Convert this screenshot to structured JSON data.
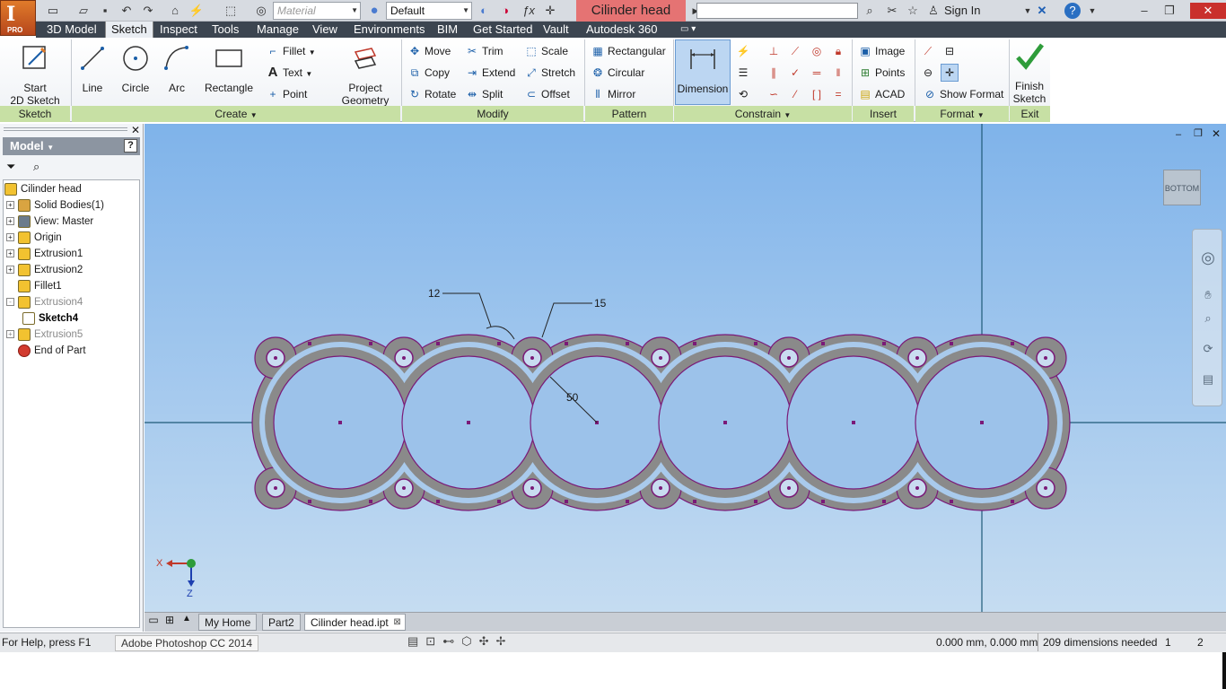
{
  "titlebar": {
    "material_placeholder": "Material",
    "appearance_value": "Default",
    "document_title": "Cilinder head",
    "signin_label": "Sign In"
  },
  "menu_tabs": [
    "3D Model",
    "Sketch",
    "Inspect",
    "Tools",
    "Manage",
    "View",
    "Environments",
    "BIM",
    "Get Started",
    "Vault",
    "Autodesk 360"
  ],
  "active_tab": "Sketch",
  "ribbon": {
    "sketch_panel": {
      "title": "Sketch",
      "start_label_1": "Start",
      "start_label_2": "2D Sketch"
    },
    "create_panel": {
      "title": "Create",
      "line": "Line",
      "circle": "Circle",
      "arc": "Arc",
      "rectangle": "Rectangle",
      "fillet": "Fillet",
      "text": "Text",
      "point": "Point",
      "project_1": "Project",
      "project_2": "Geometry"
    },
    "modify_panel": {
      "title": "Modify",
      "move": "Move",
      "copy": "Copy",
      "rotate": "Rotate",
      "trim": "Trim",
      "extend": "Extend",
      "split": "Split",
      "scale": "Scale",
      "stretch": "Stretch",
      "offset": "Offset"
    },
    "pattern_panel": {
      "title": "Pattern",
      "rectangular": "Rectangular",
      "circular": "Circular",
      "mirror": "Mirror"
    },
    "constrain_panel": {
      "title": "Constrain",
      "dimension": "Dimension"
    },
    "insert_panel": {
      "title": "Insert",
      "image": "Image",
      "points": "Points",
      "acad": "ACAD"
    },
    "format_panel": {
      "title": "Format",
      "show_format": "Show Format"
    },
    "exit_panel": {
      "title": "Exit",
      "finish_1": "Finish",
      "finish_2": "Sketch"
    }
  },
  "browser": {
    "header": "Model",
    "items": [
      {
        "label": "Cilinder head",
        "icon": "part-icon",
        "indent": 0,
        "expander": "",
        "grey": false
      },
      {
        "label": "Solid Bodies(1)",
        "icon": "solid-bodies-icon",
        "indent": 1,
        "expander": "+",
        "grey": false
      },
      {
        "label": "View: Master",
        "icon": "view-icon",
        "indent": 1,
        "expander": "+",
        "grey": false
      },
      {
        "label": "Origin",
        "icon": "folder-icon",
        "indent": 1,
        "expander": "+",
        "grey": false
      },
      {
        "label": "Extrusion1",
        "icon": "extrusion-icon",
        "indent": 1,
        "expander": "+",
        "grey": false
      },
      {
        "label": "Extrusion2",
        "icon": "extrusion-icon",
        "indent": 1,
        "expander": "+",
        "grey": false
      },
      {
        "label": "Fillet1",
        "icon": "fillet-icon",
        "indent": 1,
        "expander": "",
        "grey": false
      },
      {
        "label": "Extrusion4",
        "icon": "extrusion-icon",
        "indent": 1,
        "expander": "-",
        "grey": true
      },
      {
        "label": "Sketch4",
        "icon": "sketch-icon",
        "indent": 2,
        "expander": "",
        "grey": false,
        "bold": true
      },
      {
        "label": "Extrusion5",
        "icon": "extrusion-icon",
        "indent": 1,
        "expander": "+",
        "grey": true
      },
      {
        "label": "End of Part",
        "icon": "end-of-part-icon",
        "indent": 1,
        "expander": "",
        "grey": false
      }
    ]
  },
  "viewport": {
    "viewcube_label": "BOTTOM",
    "dimensions": {
      "d1": "12",
      "d2": "15",
      "d3": "50"
    },
    "triad": {
      "x": "X",
      "z": "Z"
    }
  },
  "doc_tabs": [
    "My Home",
    "Part2",
    "Cilinder head.ipt"
  ],
  "status": {
    "help": "For Help, press F1",
    "taskbar_app": "Adobe Photoshop CC 2014",
    "coords": "0.000 mm, 0.000 mm",
    "dims_needed": "209 dimensions needed",
    "count1": "1",
    "count2": "2"
  },
  "colors": {
    "accent_green": "#c7e0a4",
    "title_red": "#e57373",
    "sketch_purple": "#7a1a78",
    "body_grey": "#8a8a8a"
  }
}
